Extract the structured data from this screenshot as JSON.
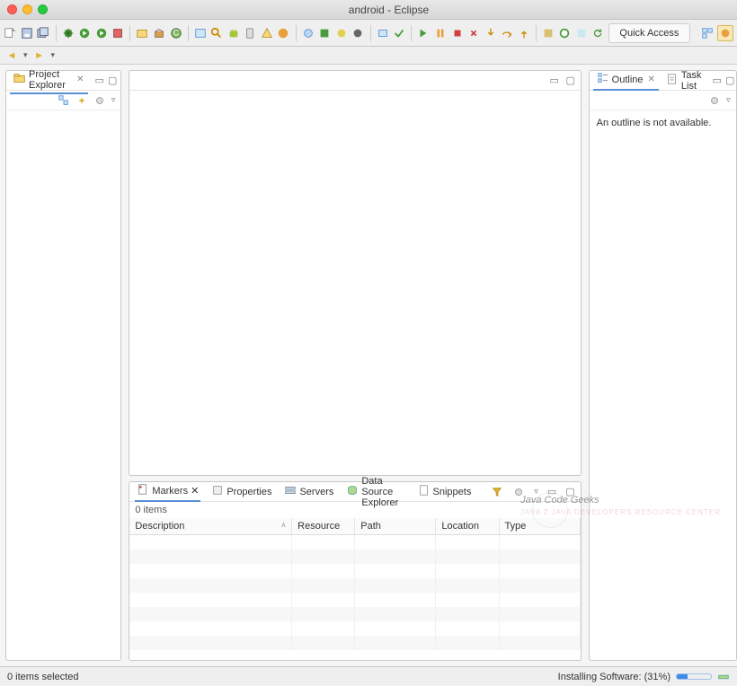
{
  "window": {
    "title": "android - Eclipse"
  },
  "quick_access": {
    "label": "Quick Access"
  },
  "left": {
    "view": {
      "title": "Project Explorer"
    }
  },
  "right": {
    "outline_tab": "Outline",
    "task_tab": "Task List",
    "outline_message": "An outline is not available."
  },
  "bottom": {
    "tabs": {
      "markers": "Markers",
      "properties": "Properties",
      "servers": "Servers",
      "dse": "Data Source Explorer",
      "snippets": "Snippets"
    },
    "items_count": "0 items",
    "columns": {
      "description": "Description",
      "resource": "Resource",
      "path": "Path",
      "location": "Location",
      "type": "Type"
    }
  },
  "status": {
    "selection": "0 items selected",
    "progress_label": "Installing Software: (31%)",
    "progress_percent": 31
  },
  "watermark": {
    "text": "Java Code Geeks",
    "sub": "JAVA 2 JAVA DEVELOPERS RESOURCE CENTER"
  }
}
